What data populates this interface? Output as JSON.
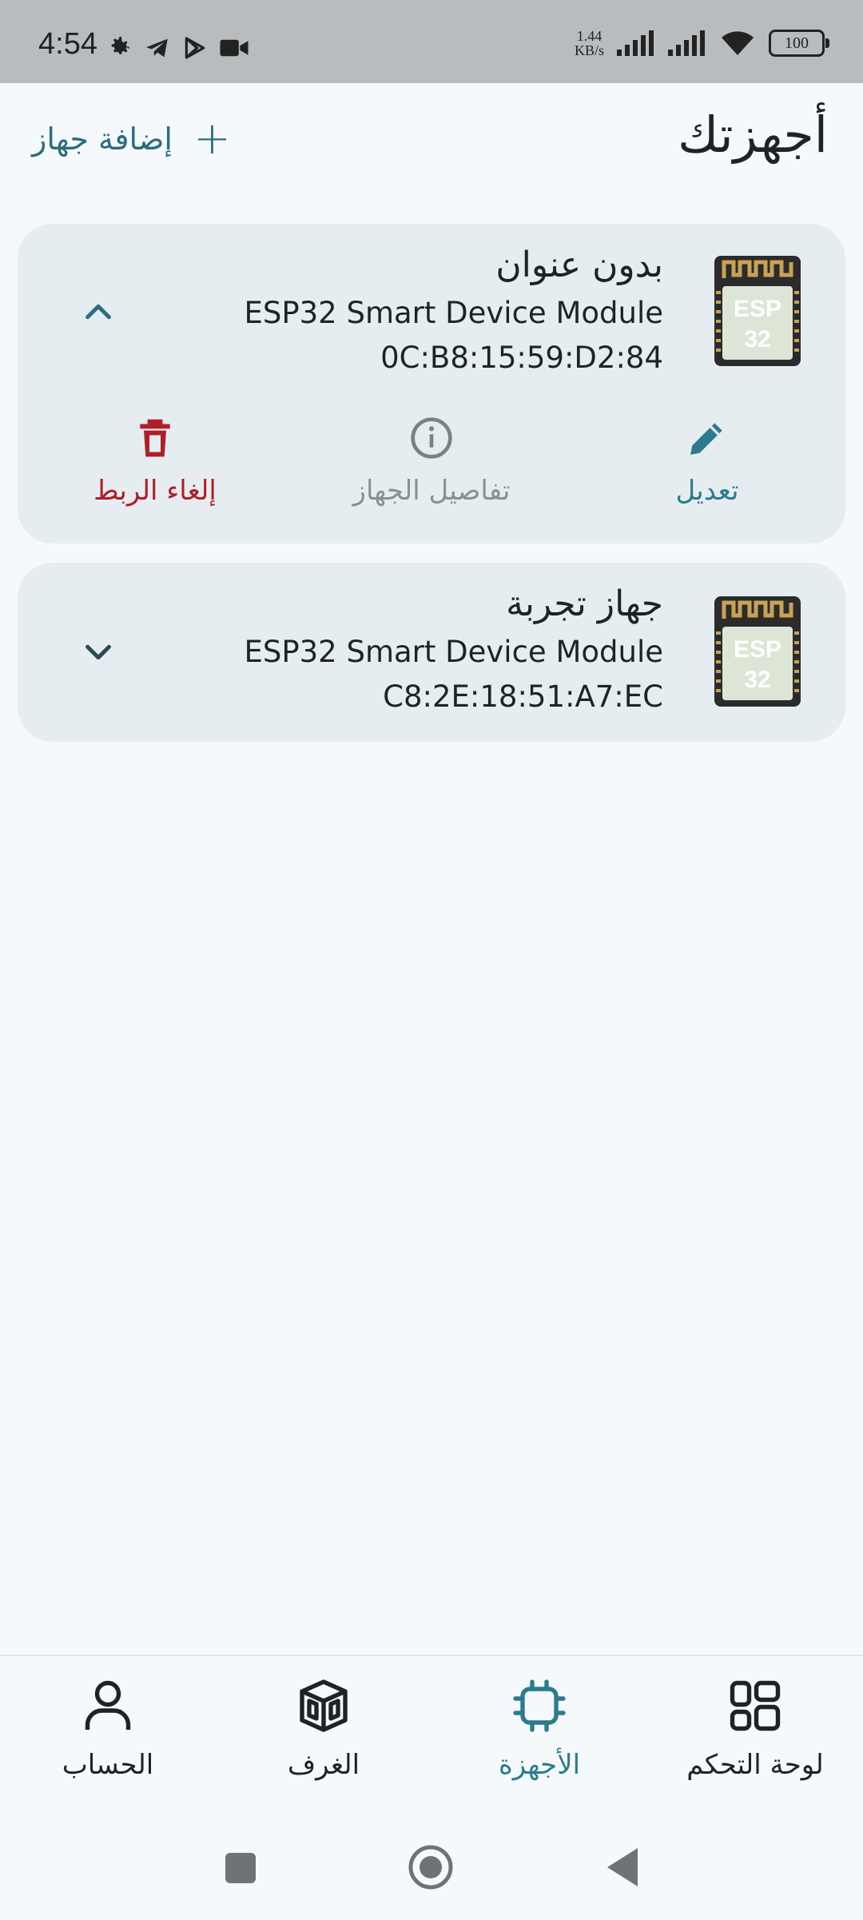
{
  "status_bar": {
    "time": "4:54",
    "net_speed_value": "1.44",
    "net_speed_unit": "KB/s",
    "battery": "100",
    "icons": [
      "settings-icon",
      "telegram-icon",
      "play-store-icon",
      "video-camera-icon",
      "signal-icon",
      "signal-icon",
      "wifi-icon",
      "battery-icon"
    ]
  },
  "header": {
    "title": "أجهزتك",
    "add_device_label": "إضافة جهاز",
    "add_icon": "plus-icon"
  },
  "devices": [
    {
      "name": "بدون عنوان",
      "model": "ESP32 Smart Device Module",
      "mac": "0C:B8:15:59:D2:84",
      "expanded": true,
      "chip_text": [
        "ESP",
        "32"
      ],
      "actions": {
        "edit_label": "تعديل",
        "details_label": "تفاصيل الجهاز",
        "unlink_label": "إلغاء الربط"
      }
    },
    {
      "name": "جهاز تجربة",
      "model": "ESP32 Smart Device Module",
      "mac": "C8:2E:18:51:A7:EC",
      "expanded": false,
      "chip_text": [
        "ESP",
        "32"
      ]
    }
  ],
  "bottom_nav": [
    {
      "label": "لوحة التحكم",
      "icon": "dashboard-icon",
      "active": false
    },
    {
      "label": "الأجهزة",
      "icon": "chip-icon",
      "active": true
    },
    {
      "label": "الغرف",
      "icon": "rooms-icon",
      "active": false
    },
    {
      "label": "الحساب",
      "icon": "account-icon",
      "active": false
    }
  ],
  "colors": {
    "accent": "#2b7c8c",
    "danger": "#b01e28",
    "card_bg": "#e6edf1",
    "page_bg": "#f5f9fb",
    "status_bar_bg": "#b8bcbf",
    "muted": "#8a8f93"
  }
}
